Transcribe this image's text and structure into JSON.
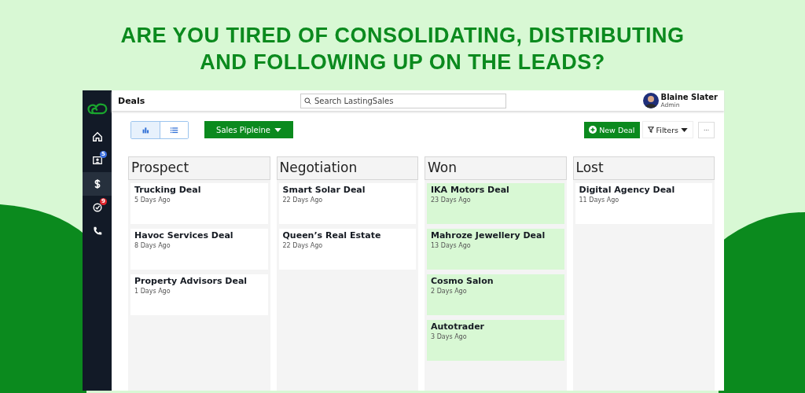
{
  "headline": "ARE YOU TIRED OF CONSOLIDATING, DISTRIBUTING AND FOLLOWING UP ON THE LEADS?",
  "sidebar": {
    "items": [
      {
        "kind": "home",
        "selected": false
      },
      {
        "kind": "contacts",
        "selected": false,
        "badge": "5",
        "color": "#3b6fe0"
      },
      {
        "kind": "deals",
        "selected": true
      },
      {
        "kind": "tasks",
        "selected": false,
        "badge": "9",
        "color": "#e0242b"
      },
      {
        "kind": "calls",
        "selected": false
      }
    ]
  },
  "top_bar": {
    "title": "Deals",
    "search": {
      "placeholder": "Search LastingSales"
    },
    "user": {
      "name": "Blaine Slater",
      "role": "Admin"
    }
  },
  "toolbar": {
    "view_toggle": [
      {
        "kind": "chart",
        "selected": true
      },
      {
        "kind": "list",
        "selected": false
      }
    ],
    "pipeline": "Sales Pipleine",
    "new_deal": "New Deal",
    "filters": "Filters",
    "more": "···"
  },
  "columns": [
    {
      "title": "Prospect",
      "highlighted": false,
      "cards": [
        {
          "name": "Trucking Deal",
          "age": "5 Days Ago"
        },
        {
          "name": "Havoc Services Deal",
          "age": "8 Days Ago"
        },
        {
          "name": "Property Advisors Deal",
          "age": "1 Days Ago"
        }
      ]
    },
    {
      "title": "Negotiation",
      "highlighted": false,
      "cards": [
        {
          "name": "Smart Solar Deal",
          "age": "22 Days Ago"
        },
        {
          "name": "Queen’s Real Estate",
          "age": "22 Days Ago"
        }
      ]
    },
    {
      "title": "Won",
      "highlighted": true,
      "cards": [
        {
          "name": "IKA Motors Deal",
          "age": "23 Days Ago"
        },
        {
          "name": "Mahroze Jewellery Deal",
          "age": "13 Days Ago"
        },
        {
          "name": "Cosmo Salon",
          "age": "2 Days Ago"
        },
        {
          "name": "Autotrader",
          "age": "3 Days Ago"
        }
      ]
    },
    {
      "title": "Lost",
      "highlighted": false,
      "cards": [
        {
          "name": "Digital Agency Deal",
          "age": "11 Days Ago"
        }
      ]
    }
  ]
}
